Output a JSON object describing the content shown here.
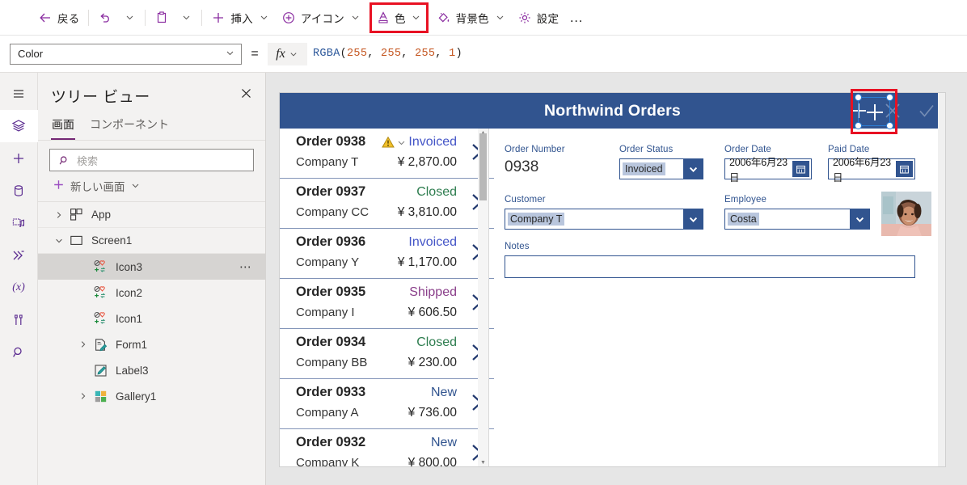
{
  "command_bar": {
    "items": [
      {
        "name": "back",
        "icon": "arrow-left-icon",
        "label": "戻る",
        "caret": false
      },
      {
        "name": "undo",
        "icon": "undo-icon",
        "label": "",
        "caret": true
      },
      {
        "name": "paste",
        "icon": "clipboard-icon",
        "label": "",
        "caret": true
      },
      {
        "name": "insert",
        "icon": "plus-icon",
        "label": "挿入",
        "caret": true
      },
      {
        "name": "icon",
        "icon": "circle-plus-icon",
        "label": "アイコン",
        "caret": true
      },
      {
        "name": "color",
        "icon": "font-color-icon",
        "label": "色",
        "caret": true,
        "highlighted": true
      },
      {
        "name": "fill",
        "icon": "paint-bucket-icon",
        "label": "背景色",
        "caret": true
      },
      {
        "name": "settings",
        "icon": "gear-icon",
        "label": "設定",
        "caret": false
      }
    ],
    "overflow_label": "…",
    "highlight_color": "#e81123"
  },
  "formula_bar": {
    "property_selected": "Color",
    "equals": "=",
    "fx_label": "fx",
    "formula_tokens": [
      {
        "text": "RGBA",
        "type": "fn"
      },
      {
        "text": "(",
        "type": "pu"
      },
      {
        "text": "255",
        "type": "num"
      },
      {
        "text": ", ",
        "type": "pu"
      },
      {
        "text": "255",
        "type": "num"
      },
      {
        "text": ", ",
        "type": "pu"
      },
      {
        "text": "255",
        "type": "num"
      },
      {
        "text": ", ",
        "type": "pu"
      },
      {
        "text": "1",
        "type": "num"
      },
      {
        "text": ")",
        "type": "pu"
      }
    ],
    "formula_text": "RGBA(255, 255, 255, 1)"
  },
  "rail": {
    "items": [
      {
        "name": "hamburger-icon",
        "active": false
      },
      {
        "name": "tree-view-layers-icon",
        "active": true
      },
      {
        "name": "insert-plus-icon",
        "active": false
      },
      {
        "name": "data-source-icon",
        "active": false
      },
      {
        "name": "media-icon",
        "active": false
      },
      {
        "name": "power-automate-icon",
        "active": false
      },
      {
        "name": "variables-icon",
        "active": false,
        "label": "(x)"
      },
      {
        "name": "tools-icon",
        "active": false
      },
      {
        "name": "search-icon",
        "active": false
      }
    ]
  },
  "tree_view": {
    "title": "ツリー ビュー",
    "close_label": "×",
    "tabs": [
      {
        "label": "画面",
        "selected": true
      },
      {
        "label": "コンポーネント",
        "selected": false
      }
    ],
    "search_placeholder": "検索",
    "new_screen_label": "新しい画面",
    "nodes": [
      {
        "label": "App",
        "icon": "app-icon",
        "level": 0,
        "expandable": true,
        "expanded": false,
        "selected": false,
        "menu": false
      },
      {
        "label": "Screen1",
        "icon": "screen-icon",
        "level": 0,
        "expandable": true,
        "expanded": true,
        "selected": false,
        "menu": false
      },
      {
        "label": "Icon3",
        "icon": "icon-control-icon",
        "level": 1,
        "expandable": false,
        "expanded": false,
        "selected": true,
        "menu": true
      },
      {
        "label": "Icon2",
        "icon": "icon-control-icon",
        "level": 1,
        "expandable": false,
        "expanded": false,
        "selected": false,
        "menu": false
      },
      {
        "label": "Icon1",
        "icon": "icon-control-icon",
        "level": 1,
        "expandable": false,
        "expanded": false,
        "selected": false,
        "menu": false
      },
      {
        "label": "Form1",
        "icon": "form-icon",
        "level": 1,
        "expandable": true,
        "expanded": false,
        "selected": false,
        "menu": false
      },
      {
        "label": "Label3",
        "icon": "label-icon",
        "level": 1,
        "expandable": false,
        "expanded": false,
        "selected": false,
        "menu": false
      },
      {
        "label": "Gallery1",
        "icon": "gallery-icon",
        "level": 1,
        "expandable": true,
        "expanded": false,
        "selected": false,
        "menu": false
      }
    ],
    "menu_dots": "⋯"
  },
  "canvas": {
    "app_header": {
      "title": "Northwind Orders",
      "background": "#31548f",
      "actions": [
        {
          "name": "add-order-icon",
          "glyph": "plus",
          "selected": true
        },
        {
          "name": "cancel-icon",
          "glyph": "x",
          "selected": false
        },
        {
          "name": "confirm-icon",
          "glyph": "check",
          "selected": false
        }
      ]
    },
    "gallery": {
      "rows": [
        {
          "order": "Order 0938",
          "company": "Company T",
          "status": "Invoiced",
          "status_color": "#4455c7",
          "amount": "¥ 2,870.00",
          "warning": true
        },
        {
          "order": "Order 0937",
          "company": "Company CC",
          "status": "Closed",
          "status_color": "#2e7d4f",
          "amount": "¥ 3,810.00",
          "warning": false
        },
        {
          "order": "Order 0936",
          "company": "Company Y",
          "status": "Invoiced",
          "status_color": "#4455c7",
          "amount": "¥ 1,170.00",
          "warning": false
        },
        {
          "order": "Order 0935",
          "company": "Company I",
          "status": "Shipped",
          "status_color": "#8a3f8a",
          "amount": "¥ 606.50",
          "warning": false
        },
        {
          "order": "Order 0934",
          "company": "Company BB",
          "status": "Closed",
          "status_color": "#2e7d4f",
          "amount": "¥ 230.00",
          "warning": false
        },
        {
          "order": "Order 0933",
          "company": "Company A",
          "status": "New",
          "status_color": "#31548f",
          "amount": "¥ 736.00",
          "warning": false
        },
        {
          "order": "Order 0932",
          "company": "Company K",
          "status": "New",
          "status_color": "#31548f",
          "amount": "¥ 800.00",
          "warning": false
        }
      ]
    },
    "form": {
      "order_number_label": "Order Number",
      "order_number_value": "0938",
      "order_status_label": "Order Status",
      "order_status_value": "Invoiced",
      "order_date_label": "Order Date",
      "order_date_value": "2006年6月23日",
      "paid_date_label": "Paid Date",
      "paid_date_value": "2006年6月23日",
      "customer_label": "Customer",
      "customer_value": "Company T",
      "employee_label": "Employee",
      "employee_value": "Costa",
      "employee_photo_name": "employee-photo",
      "notes_label": "Notes",
      "notes_value": ""
    }
  }
}
